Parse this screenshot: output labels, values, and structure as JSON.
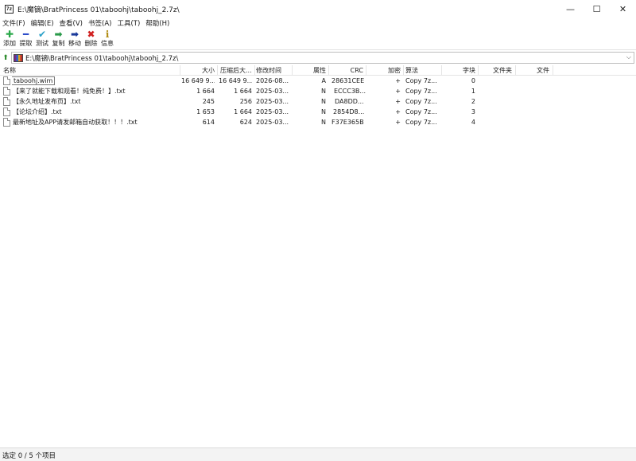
{
  "window": {
    "title": "E:\\魔镝\\BratPrincess 01\\taboohj\\taboohj_2.7z\\",
    "app_icon_text": "7z",
    "minimize": "—",
    "maximize": "☐",
    "close": "✕"
  },
  "menu": [
    "文件(F)",
    "编辑(E)",
    "查看(V)",
    "书签(A)",
    "工具(T)",
    "帮助(H)"
  ],
  "toolbar": [
    {
      "label": "添加",
      "icon": "plus-icon",
      "glyph": "✚",
      "color": "#2aa84a"
    },
    {
      "label": "提取",
      "icon": "minus-icon",
      "glyph": "━",
      "color": "#2a4ac8"
    },
    {
      "label": "测试",
      "icon": "check-icon",
      "glyph": "✔",
      "color": "#2aa0c8"
    },
    {
      "label": "复制",
      "icon": "copy-arrow-icon",
      "glyph": "➡",
      "color": "#2a9a4a"
    },
    {
      "label": "移动",
      "icon": "move-arrow-icon",
      "glyph": "➡",
      "color": "#1a3a9a"
    },
    {
      "label": "删除",
      "icon": "delete-x-icon",
      "glyph": "✖",
      "color": "#d02020"
    },
    {
      "label": "信息",
      "icon": "info-icon",
      "glyph": "ℹ",
      "color": "#b08a10"
    }
  ],
  "address": {
    "up_glyph": "⬆",
    "path": "E:\\魔镝\\BratPrincess 01\\taboohj\\taboohj_2.7z\\",
    "dropdown_glyph": "⌵"
  },
  "columns": {
    "name": "名称",
    "size": "大小",
    "packed": "压缩后大...",
    "modified": "修改时间",
    "attr": "属性",
    "crc": "CRC",
    "encrypted": "加密",
    "method": "算法",
    "block": "字块",
    "folders": "文件夹",
    "files": "文件"
  },
  "files": [
    {
      "name": "taboohj.wim",
      "size": "16 649 9...",
      "packed": "16 649 9...",
      "modified": "2026-08...",
      "attr": "A",
      "crc": "28631CEE",
      "encrypted": "+",
      "method": "Copy 7z...",
      "block": "0"
    },
    {
      "name": "【来了就能下载和观看！纯免费！】.txt",
      "size": "1 664",
      "packed": "1 664",
      "modified": "2025-03...",
      "attr": "N",
      "crc": "ECCC3B...",
      "encrypted": "+",
      "method": "Copy 7z...",
      "block": "1"
    },
    {
      "name": "【永久地址发布页】.txt",
      "size": "245",
      "packed": "256",
      "modified": "2025-03...",
      "attr": "N",
      "crc": "DA8DD...",
      "encrypted": "+",
      "method": "Copy 7z...",
      "block": "2"
    },
    {
      "name": "【论坛介绍】.txt",
      "size": "1 653",
      "packed": "1 664",
      "modified": "2025-03...",
      "attr": "N",
      "crc": "2854D8...",
      "encrypted": "+",
      "method": "Copy 7z...",
      "block": "3"
    },
    {
      "name": "最新地址及APP请发邮箱自动获取！！！.txt",
      "size": "614",
      "packed": "624",
      "modified": "2025-03...",
      "attr": "N",
      "crc": "F37E365B",
      "encrypted": "+",
      "method": "Copy 7z...",
      "block": "4"
    }
  ],
  "status": "选定 0 / 5 个项目"
}
